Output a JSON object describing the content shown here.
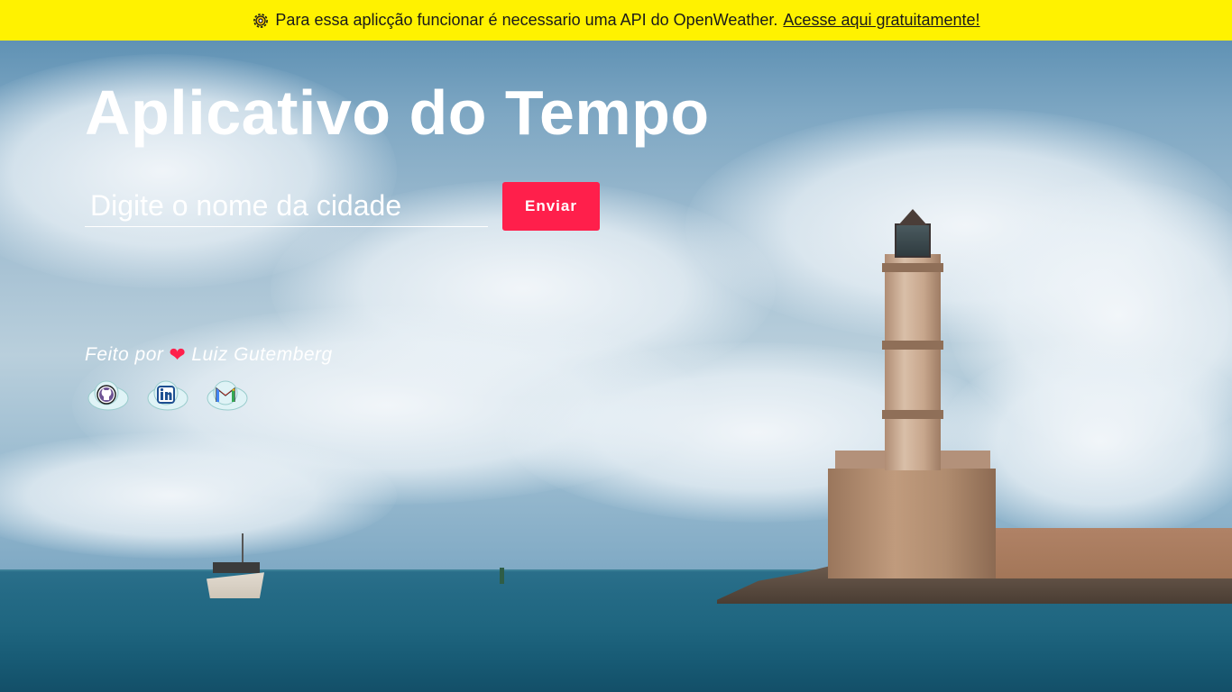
{
  "banner": {
    "icon": "gear-icon",
    "text": "Para essa aplicção funcionar é necessario uma API do OpenWeather.",
    "link_label": "Acesse aqui gratuitamente!",
    "background_color": "#fff200"
  },
  "main": {
    "title": "Aplicativo do Tempo",
    "search": {
      "placeholder": "Digite o nome da cidade",
      "value": ""
    },
    "submit_label": "Enviar",
    "accent_color": "#ff1f4b"
  },
  "credits": {
    "prefix": "Feito por",
    "heart_icon": "heart-icon",
    "author": "Luiz Gutemberg"
  },
  "socials": [
    {
      "icon": "github-icon"
    },
    {
      "icon": "linkedin-icon"
    },
    {
      "icon": "gmail-icon"
    }
  ]
}
